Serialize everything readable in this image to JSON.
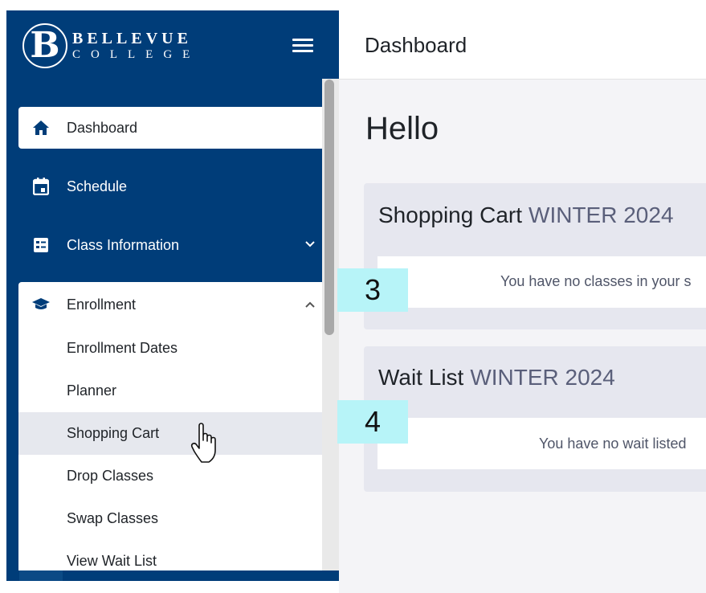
{
  "brand": {
    "line1": "BELLEVUE",
    "line2": "COLLEGE",
    "mark": "B",
    "color": "#003d79"
  },
  "header": {
    "title": "Dashboard"
  },
  "nav": {
    "dashboard": "Dashboard",
    "schedule": "Schedule",
    "class_information": "Class Information",
    "enrollment": "Enrollment",
    "enrollment_items": [
      "Enrollment Dates",
      "Planner",
      "Shopping Cart",
      "Drop Classes",
      "Swap Classes",
      "View Wait List"
    ]
  },
  "main": {
    "greeting": "Hello",
    "shopping_cart": {
      "title": "Shopping Cart",
      "term": "WINTER 2024",
      "message": "You have no classes in your s"
    },
    "wait_list": {
      "title": "Wait List",
      "term": "WINTER 2024",
      "message": "You have no wait listed"
    }
  },
  "annotations": {
    "badge1": "3",
    "badge2": "4",
    "color": "#b7f4f8"
  }
}
